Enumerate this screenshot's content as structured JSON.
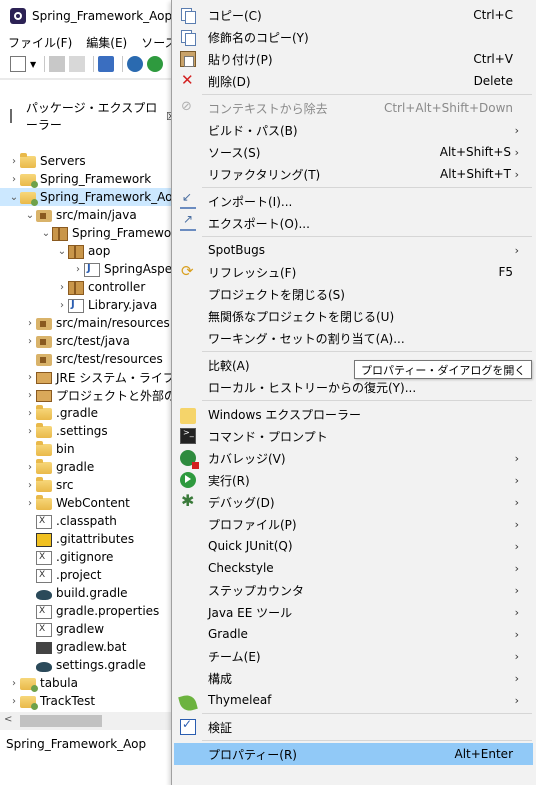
{
  "window": {
    "title": "Spring_Framework_Aop/bu",
    "menus": [
      "ファイル(F)",
      "編集(E)",
      "ソース(S)"
    ]
  },
  "explorer": {
    "title": "パッケージ・エクスプローラー",
    "close": "☒",
    "tree": [
      {
        "label": "Servers",
        "icon": "folder",
        "indent": 0,
        "twisty": ">"
      },
      {
        "label": "Spring_Framework",
        "icon": "project",
        "indent": 0,
        "twisty": ">"
      },
      {
        "label": "Spring_Framework_Aop",
        "icon": "project",
        "indent": 0,
        "twisty": "v",
        "selected": true
      },
      {
        "label": "src/main/java",
        "icon": "srcfolder",
        "indent": 1,
        "twisty": "v"
      },
      {
        "label": "Spring_Framework",
        "icon": "package",
        "indent": 2,
        "twisty": "v"
      },
      {
        "label": "aop",
        "icon": "package",
        "indent": 3,
        "twisty": "v"
      },
      {
        "label": "SpringAspe",
        "icon": "java",
        "indent": 4,
        "twisty": ">"
      },
      {
        "label": "controller",
        "icon": "package",
        "indent": 3,
        "twisty": ">"
      },
      {
        "label": "Library.java",
        "icon": "java",
        "indent": 3,
        "twisty": ">"
      },
      {
        "label": "src/main/resources",
        "icon": "srcfolder",
        "indent": 1,
        "twisty": ">"
      },
      {
        "label": "src/test/java",
        "icon": "srcfolder",
        "indent": 1,
        "twisty": ">"
      },
      {
        "label": "src/test/resources",
        "icon": "srcfolder",
        "indent": 1,
        "twisty": ""
      },
      {
        "label": "JRE システム・ライブラリー",
        "icon": "library",
        "indent": 1,
        "twisty": ">"
      },
      {
        "label": "プロジェクトと外部の依存",
        "icon": "library",
        "indent": 1,
        "twisty": ">"
      },
      {
        "label": ".gradle",
        "icon": "folder",
        "indent": 1,
        "twisty": ">"
      },
      {
        "label": ".settings",
        "icon": "folder",
        "indent": 1,
        "twisty": ">"
      },
      {
        "label": "bin",
        "icon": "folder",
        "indent": 1,
        "twisty": ""
      },
      {
        "label": "gradle",
        "icon": "folder",
        "indent": 1,
        "twisty": ">"
      },
      {
        "label": "src",
        "icon": "folder",
        "indent": 1,
        "twisty": ">"
      },
      {
        "label": "WebContent",
        "icon": "folder",
        "indent": 1,
        "twisty": ">"
      },
      {
        "label": ".classpath",
        "icon": "xfile",
        "indent": 1,
        "twisty": ""
      },
      {
        "label": ".gitattributes",
        "icon": "gitattr",
        "indent": 1,
        "twisty": ""
      },
      {
        "label": ".gitignore",
        "icon": "xfile",
        "indent": 1,
        "twisty": ""
      },
      {
        "label": ".project",
        "icon": "xfile",
        "indent": 1,
        "twisty": ""
      },
      {
        "label": "build.gradle",
        "icon": "gradle",
        "indent": 1,
        "twisty": ""
      },
      {
        "label": "gradle.properties",
        "icon": "xfile",
        "indent": 1,
        "twisty": ""
      },
      {
        "label": "gradlew",
        "icon": "xfile",
        "indent": 1,
        "twisty": ""
      },
      {
        "label": "gradlew.bat",
        "icon": "bat",
        "indent": 1,
        "twisty": ""
      },
      {
        "label": "settings.gradle",
        "icon": "gradle",
        "indent": 1,
        "twisty": ""
      },
      {
        "label": "tabula",
        "icon": "project",
        "indent": 0,
        "twisty": ">"
      },
      {
        "label": "TrackTest",
        "icon": "project",
        "indent": 0,
        "twisty": ">"
      }
    ]
  },
  "status": {
    "text": "Spring_Framework_Aop"
  },
  "context_menu": {
    "items": [
      {
        "label": "コピー(C)",
        "shortcut": "Ctrl+C",
        "icon": "copy"
      },
      {
        "label": "修飾名のコピー(Y)",
        "icon": "copy"
      },
      {
        "label": "貼り付け(P)",
        "shortcut": "Ctrl+V",
        "icon": "paste"
      },
      {
        "label": "削除(D)",
        "shortcut": "Delete",
        "icon": "delete"
      },
      {
        "sep": true
      },
      {
        "label": "コンテキストから除去",
        "shortcut": "Ctrl+Alt+Shift+Down",
        "icon": "remove",
        "disabled": true
      },
      {
        "label": "ビルド・パス(B)",
        "submenu": true
      },
      {
        "label": "ソース(S)",
        "shortcut": "Alt+Shift+S",
        "submenu": true
      },
      {
        "label": "リファクタリング(T)",
        "shortcut": "Alt+Shift+T",
        "submenu": true
      },
      {
        "sep": true
      },
      {
        "label": "インポート(I)...",
        "icon": "import"
      },
      {
        "label": "エクスポート(O)...",
        "icon": "export"
      },
      {
        "sep": true
      },
      {
        "label": "SpotBugs",
        "submenu": true
      },
      {
        "label": "リフレッシュ(F)",
        "shortcut": "F5",
        "icon": "refresh"
      },
      {
        "label": "プロジェクトを閉じる(S)"
      },
      {
        "label": "無関係なプロジェクトを閉じる(U)"
      },
      {
        "label": "ワーキング・セットの割り当て(A)..."
      },
      {
        "sep": true
      },
      {
        "label": "比較(A)",
        "submenu": true
      },
      {
        "label": "ローカル・ヒストリーからの復元(Y)..."
      },
      {
        "sep": true
      },
      {
        "label": "Windows エクスプローラー",
        "icon": "explorer"
      },
      {
        "label": "コマンド・プロンプト",
        "icon": "cmd"
      },
      {
        "label": "カバレッジ(V)",
        "icon": "coverage",
        "submenu": true
      },
      {
        "label": "実行(R)",
        "icon": "run",
        "submenu": true
      },
      {
        "label": "デバッグ(D)",
        "icon": "debug",
        "submenu": true
      },
      {
        "label": "プロファイル(P)",
        "submenu": true
      },
      {
        "label": "Quick JUnit(Q)",
        "submenu": true
      },
      {
        "label": "Checkstyle",
        "submenu": true
      },
      {
        "label": "ステップカウンタ",
        "submenu": true
      },
      {
        "label": "Java EE ツール",
        "submenu": true
      },
      {
        "label": "Gradle",
        "submenu": true
      },
      {
        "label": "チーム(E)",
        "submenu": true
      },
      {
        "label": "構成",
        "submenu": true
      },
      {
        "label": "Thymeleaf",
        "icon": "leaf",
        "submenu": true
      },
      {
        "sep": true
      },
      {
        "label": "検証",
        "icon": "check"
      },
      {
        "sep": true
      },
      {
        "label": "プロパティー(R)",
        "shortcut": "Alt+Enter",
        "highlight": true
      }
    ]
  },
  "tooltip": {
    "text": "プロパティー・ダイアログを開く"
  }
}
